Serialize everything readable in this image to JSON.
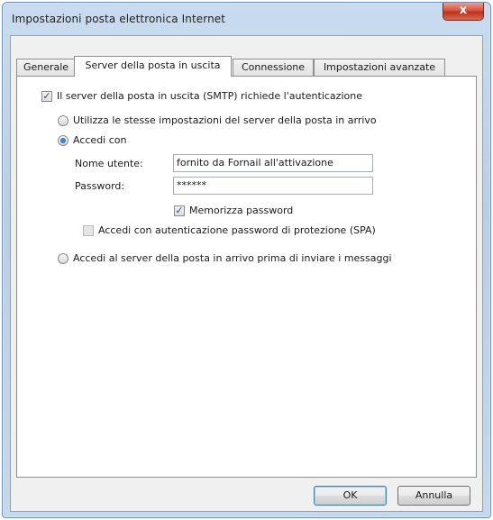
{
  "window": {
    "title": "Impostazioni posta elettronica Internet",
    "close_label": "x"
  },
  "tabs": [
    {
      "label": "Generale"
    },
    {
      "label": "Server della posta in uscita"
    },
    {
      "label": "Connessione"
    },
    {
      "label": "Impostazioni avanzate"
    }
  ],
  "active_tab": "Server della posta in uscita",
  "smtp_auth": {
    "label": "Il server della posta in uscita (SMTP) richiede l'autenticazione",
    "checked": true
  },
  "radio_same_settings": {
    "label": "Utilizza le stesse impostazioni del server della posta in arrivo",
    "selected": false
  },
  "radio_login": {
    "label": "Accedi con",
    "selected": true
  },
  "username": {
    "label": "Nome utente:",
    "value": "fornito da Fornail all'attivazione"
  },
  "password": {
    "label": "Password:",
    "value": "******"
  },
  "remember_password": {
    "label": "Memorizza password",
    "checked": true
  },
  "spa": {
    "label": "Accedi con autenticazione password di protezione (SPA)",
    "checked": false
  },
  "radio_pop_before_smtp": {
    "label": "Accedi al server della posta in arrivo prima di inviare i messaggi",
    "selected": false
  },
  "buttons": {
    "ok": "OK",
    "cancel": "Annulla"
  }
}
